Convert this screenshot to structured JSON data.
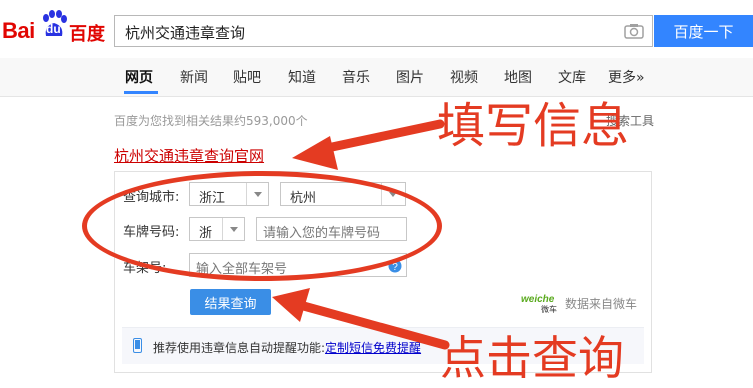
{
  "logo": {
    "latin": "Bai",
    "du": "du",
    "chinese": "百度"
  },
  "search": {
    "query": "杭州交通违章查询",
    "button": "百度一下"
  },
  "nav": {
    "items": [
      "网页",
      "新闻",
      "贴吧",
      "知道",
      "音乐",
      "图片",
      "视频",
      "地图",
      "文库",
      "更多»"
    ],
    "active": "网页"
  },
  "results": {
    "count_text": "百度为您找到相关结果约593,000个",
    "tools": "搜索工具"
  },
  "official": {
    "title": "杭州交通违章查询",
    "suffix": "官网"
  },
  "form": {
    "city_label": "查询城市:",
    "province_value": "浙江",
    "city_value": "杭州",
    "plate_label": "车牌号码:",
    "plate_prefix": "浙",
    "plate_placeholder": "请输入您的车牌号码",
    "frame_label": "车架号:",
    "frame_placeholder": "输入全部车架号",
    "submit": "结果查询",
    "source_logo": "weiche 微车",
    "source_text": "数据来自微车"
  },
  "reminder": {
    "text": "推荐使用违章信息自动提醒功能:",
    "link": "定制短信免费提醒"
  },
  "annotations": {
    "fill_info": "填写信息",
    "click_query": "点击查询"
  },
  "colors": {
    "brand_red": "#e10602",
    "search_blue": "#3385ff",
    "annotation_red": "#e43b22"
  }
}
